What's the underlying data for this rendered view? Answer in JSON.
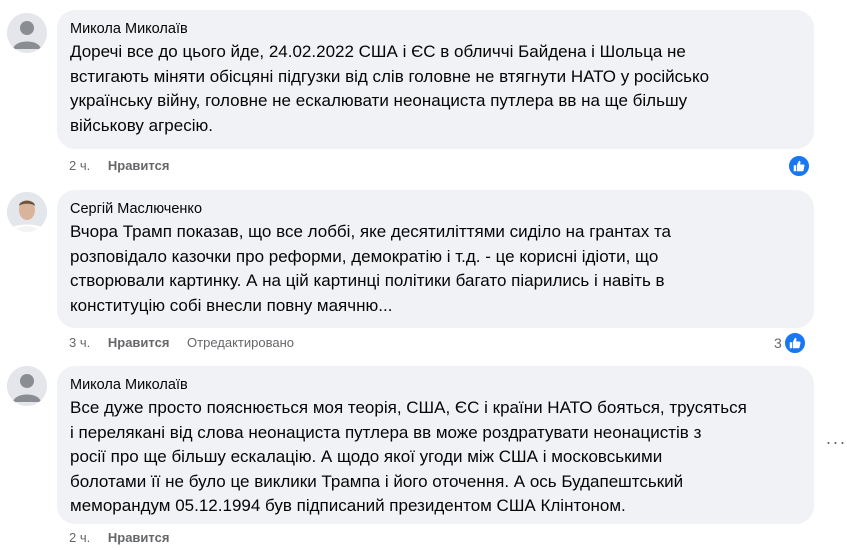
{
  "comments": [
    {
      "author": "Микола Миколаїв",
      "lines": [
        "Доречі все до цього йде, 24.02.2022 США і ЄС в обличчі Байдена і Шольца не",
        "встигають міняти обісцяні підгузки від слів головне не втягнути НАТО у російсько",
        "українську війну, головне не ескалювати неонациста путлера вв на ще більшу",
        "військову агресію."
      ],
      "time": "2 ч.",
      "like_label": "Нравится",
      "avatar": "default-avatar",
      "reaction_count": ""
    },
    {
      "author": "Сергій Маслюченко",
      "lines": [
        "Вчора Трамп показав, що все лоббі, яке десятиліттями сиділо на грантах та",
        "розповідало казочки про реформи, демократію і т.д. - це корисні ідіоти, що",
        "створювали картинку. А на цій картинці політики багато піарились і навіть в",
        "конституцію собі внесли повну маячню..."
      ],
      "time": "3 ч.",
      "like_label": "Нравится",
      "edited_label": "Отредактировано",
      "avatar": "photo-avatar",
      "reaction_count": "3"
    },
    {
      "author": "Микола Миколаїв",
      "lines": [
        "Все дуже просто пояснюється моя теорія, США, ЄС і країни НАТО бояться, трусяться",
        "і перелякані від слова неонациста путлера вв може роздратувати неонацистів з",
        "росії про ще більшу ескалацію. А щодо якої угоди між США і московськими",
        "болотами її не було це виклики Трампа і його оточення. А ось Будапештський",
        "меморандум 05.12.1994 був підписаний президентом США Клінтоном."
      ],
      "time": "2 ч.",
      "like_label": "Нравится",
      "avatar": "default-avatar"
    }
  ],
  "icons": {
    "like": "thumbs-up-icon",
    "more": "more-options-icon"
  },
  "colors": {
    "bubble": "#f0f2f5",
    "like_blue": "#1877f2",
    "meta_text": "#65676b"
  },
  "more_glyph": "···"
}
